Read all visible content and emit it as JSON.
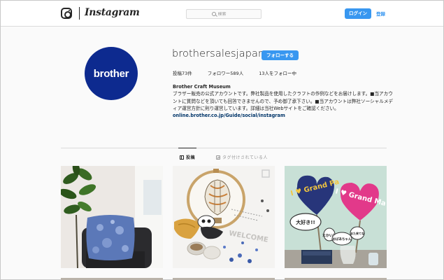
{
  "nav": {
    "wordmark": "Instagram",
    "search_placeholder": "検索",
    "login_label": "ログイン",
    "signup_label": "登録"
  },
  "profile": {
    "avatar_text": "brother",
    "username": "brothersalesjapan",
    "follow_label": "フォローする",
    "stats": {
      "posts": "投稿73件",
      "followers": "フォロワー589人",
      "following": "13人をフォロー中"
    },
    "bio": {
      "name": "Brother Craft Museum",
      "text": "ブラザー販売の公式アカウントです。弊社製品を使用したクラフトの作例などをお届けします。■当アカウントに質問などを頂いても回答できませんので、予め御了承下さい。■当アカウントは弊社ソーシャルメディア運営方針に則り運営しています。詳細は当社Webサイトをご確認ください。",
      "link": "online.brother.co.jp/Guide/social/instagram"
    }
  },
  "tabs": [
    {
      "label": "投稿"
    },
    {
      "label": "タグ付けされている人"
    }
  ],
  "posts": [
    {
      "name": "pillow-photo"
    },
    {
      "name": "embroidery-photo",
      "caption": "WELCOME"
    },
    {
      "name": "photo-props",
      "signs": [
        "I ♥ Grand Pa",
        "I ♥ Grand Ma",
        "大好き!!",
        "たかいね",
        "おばあちゃん",
        "また来てね"
      ]
    }
  ],
  "colors": {
    "accent": "#3897f0",
    "avatar_bg": "#0d2a8f",
    "link": "#003569"
  }
}
